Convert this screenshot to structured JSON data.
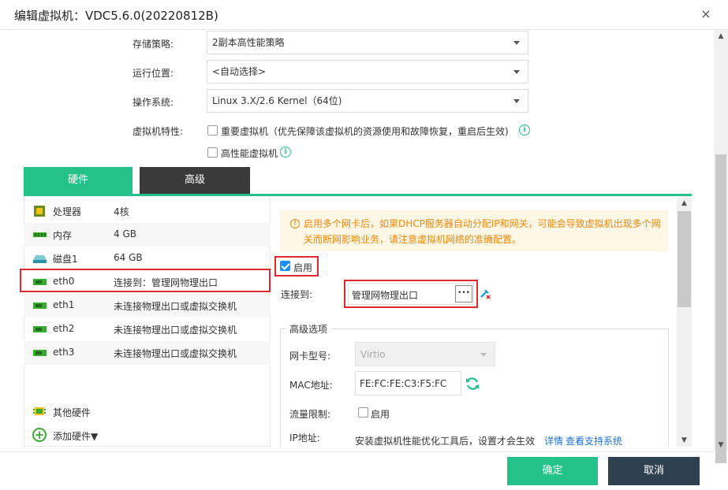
{
  "window": {
    "title": "编辑虚拟机：VDC5.6.0(20220812B)",
    "close_glyph": "×"
  },
  "form": {
    "storage_policy": {
      "label": "存储策略:",
      "value": "2副本高性能策略"
    },
    "run_location": {
      "label": "运行位置:",
      "value": "<自动选择>"
    },
    "os": {
      "label": "操作系统:",
      "value": "Linux 3.X/2.6 Kernel（64位)"
    },
    "vm_features": {
      "label": "虚拟机特性:",
      "important_vm": "重要虚拟机（优先保障该虚拟机的资源使用和故障恢复，重启后生效)",
      "important_vm_checked": false,
      "high_perf_vm": "高性能虚拟机",
      "high_perf_vm_checked": false
    }
  },
  "tabs": [
    {
      "label": "硬件",
      "active": true
    },
    {
      "label": "高级",
      "active": false
    }
  ],
  "hardware": [
    {
      "name": "处理器",
      "value": "4核",
      "icon": "cpu-icon"
    },
    {
      "name": "内存",
      "value": "4 GB",
      "icon": "memory-icon"
    },
    {
      "name": "磁盘1",
      "value": "64 GB",
      "icon": "disk-icon"
    },
    {
      "name": "eth0",
      "value": "连接到：管理网物理出口",
      "icon": "nic-icon",
      "selected": true
    },
    {
      "name": "eth1",
      "value": "未连接物理出口或虚拟交换机",
      "icon": "nic-icon"
    },
    {
      "name": "eth2",
      "value": "未连接物理出口或虚拟交换机",
      "icon": "nic-icon"
    },
    {
      "name": "eth3",
      "value": "未连接物理出口或虚拟交换机",
      "icon": "nic-icon"
    }
  ],
  "other_hw": "其他硬件",
  "add_hw": "添加硬件▼",
  "nic": {
    "warning": "启用多个网卡后，如果DHCP服务器自动分配IP和网关，可能会导致虚拟机出现多个网关而断网影响业务，请注意虚拟机网络的准确配置。",
    "enable_label": "启用",
    "enabled": true,
    "connect_label": "连接到:",
    "connect_value": "管理网物理出口",
    "browse_glyph": "•••",
    "advanced_legend": "高级选项",
    "nic_type_label": "网卡型号:",
    "nic_type_value": "Virtio",
    "mac_label": "MAC地址:",
    "mac_value": "FE:FC:FE:C3:F5:FC",
    "rate_limit_label": "流量限制:",
    "rate_limit_cb_label": "启用",
    "rate_limit_checked": false,
    "ip_label": "IP地址:",
    "ip_hint": "安装虚拟机性能优化工具后，设置才会生效",
    "ip_link_detail": "详情",
    "ip_link_support": "查看支持系统"
  },
  "footer": {
    "ok_label": "确定",
    "cancel_label": "取消"
  },
  "colors": {
    "accent": "#24c28a",
    "dark_tab": "#3a3a3a",
    "cancel": "#2f4050",
    "highlight": "#e0282e",
    "warning_text": "#f0870a",
    "warning_bg": "#fff7e6",
    "link": "#1e6fd9"
  }
}
